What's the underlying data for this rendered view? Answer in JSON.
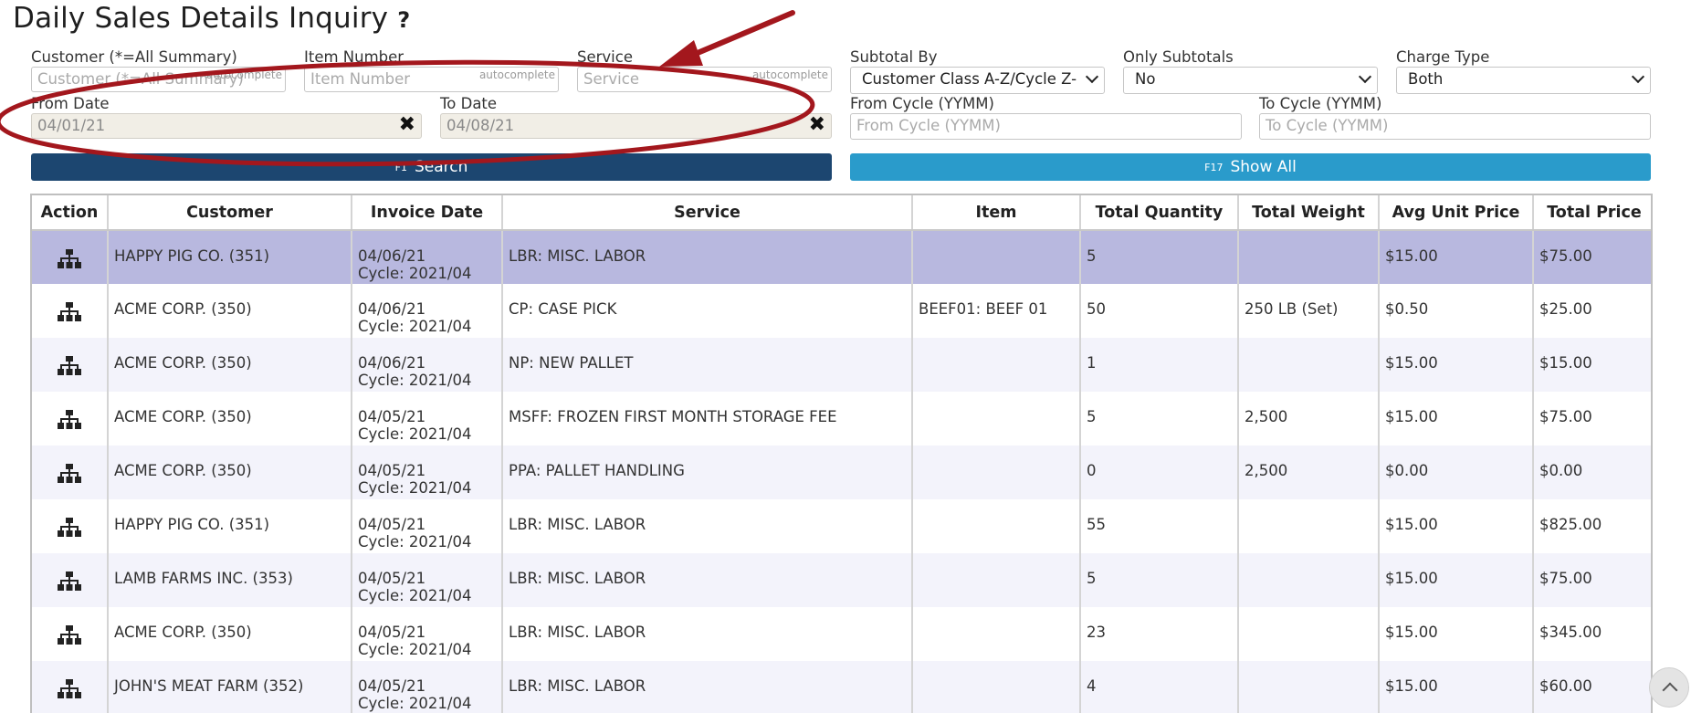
{
  "page": {
    "title": "Daily Sales Details Inquiry",
    "help": "?"
  },
  "filters": {
    "customer": {
      "label": "Customer (*=All Summary)",
      "placeholder": "Customer (*=All Summary)",
      "hint": "autocomplete"
    },
    "item": {
      "label": "Item Number",
      "placeholder": "Item Number",
      "hint": "autocomplete"
    },
    "service": {
      "label": "Service",
      "placeholder": "Service",
      "hint": "autocomplete"
    },
    "subtotal_by": {
      "label": "Subtotal By",
      "value": "Customer Class A-Z/Cycle Z-"
    },
    "only_subtotals": {
      "label": "Only Subtotals",
      "value": "No"
    },
    "charge_type": {
      "label": "Charge Type",
      "value": "Both"
    },
    "from_date": {
      "label": "From Date",
      "value": "04/01/21",
      "clear": "✖"
    },
    "to_date": {
      "label": "To Date",
      "value": "04/08/21",
      "clear": "✖"
    },
    "from_cycle": {
      "label": "From Cycle (YYMM)",
      "placeholder": "From Cycle (YYMM)"
    },
    "to_cycle": {
      "label": "To Cycle (YYMM)",
      "placeholder": "To Cycle (YYMM)"
    }
  },
  "buttons": {
    "search": {
      "key": "F1",
      "label": "Search"
    },
    "show_all": {
      "key": "F17",
      "label": "Show All"
    }
  },
  "table": {
    "headers": [
      "Action",
      "Customer",
      "Invoice Date",
      "Service",
      "Item",
      "Total Quantity",
      "Total Weight",
      "Avg Unit Price",
      "Total Price"
    ],
    "rows": [
      {
        "customer": "HAPPY PIG CO. (351)",
        "date": "04/06/21",
        "cycle": "Cycle: 2021/04",
        "service": "LBR: MISC. LABOR",
        "item": "",
        "qty": "5",
        "weight": "",
        "avg": "$15.00",
        "total": "$75.00"
      },
      {
        "customer": "ACME CORP. (350)",
        "date": "04/06/21",
        "cycle": "Cycle: 2021/04",
        "service": "CP: CASE PICK",
        "item": "BEEF01: BEEF 01",
        "qty": "50",
        "weight": "250 LB (Set)",
        "avg": "$0.50",
        "total": "$25.00"
      },
      {
        "customer": "ACME CORP. (350)",
        "date": "04/06/21",
        "cycle": "Cycle: 2021/04",
        "service": "NP: NEW PALLET",
        "item": "",
        "qty": "1",
        "weight": "",
        "avg": "$15.00",
        "total": "$15.00"
      },
      {
        "customer": "ACME CORP. (350)",
        "date": "04/05/21",
        "cycle": "Cycle: 2021/04",
        "service": "MSFF: FROZEN FIRST MONTH STORAGE FEE",
        "item": "",
        "qty": "5",
        "weight": "2,500",
        "avg": "$15.00",
        "total": "$75.00"
      },
      {
        "customer": "ACME CORP. (350)",
        "date": "04/05/21",
        "cycle": "Cycle: 2021/04",
        "service": "PPA: PALLET HANDLING",
        "item": "",
        "qty": "0",
        "weight": "2,500",
        "avg": "$0.00",
        "total": "$0.00"
      },
      {
        "customer": "HAPPY PIG CO. (351)",
        "date": "04/05/21",
        "cycle": "Cycle: 2021/04",
        "service": "LBR: MISC. LABOR",
        "item": "",
        "qty": "55",
        "weight": "",
        "avg": "$15.00",
        "total": "$825.00"
      },
      {
        "customer": "LAMB FARMS INC. (353)",
        "date": "04/05/21",
        "cycle": "Cycle: 2021/04",
        "service": "LBR: MISC. LABOR",
        "item": "",
        "qty": "5",
        "weight": "",
        "avg": "$15.00",
        "total": "$75.00"
      },
      {
        "customer": "ACME CORP. (350)",
        "date": "04/05/21",
        "cycle": "Cycle: 2021/04",
        "service": "LBR: MISC. LABOR",
        "item": "",
        "qty": "23",
        "weight": "",
        "avg": "$15.00",
        "total": "$345.00"
      },
      {
        "customer": "JOHN'S MEAT FARM (352)",
        "date": "04/05/21",
        "cycle": "Cycle: 2021/04",
        "service": "LBR: MISC. LABOR",
        "item": "",
        "qty": "4",
        "weight": "",
        "avg": "$15.00",
        "total": "$60.00"
      }
    ]
  },
  "icons": {
    "row_action": "hierarchy-icon",
    "help": "help-icon",
    "scroll_top": "chevron-up-icon"
  },
  "colors": {
    "search_button": "#1c4670",
    "show_all_button": "#2a9bcb",
    "selected_row": "#b8b8df",
    "annotation": "#a3171d"
  }
}
